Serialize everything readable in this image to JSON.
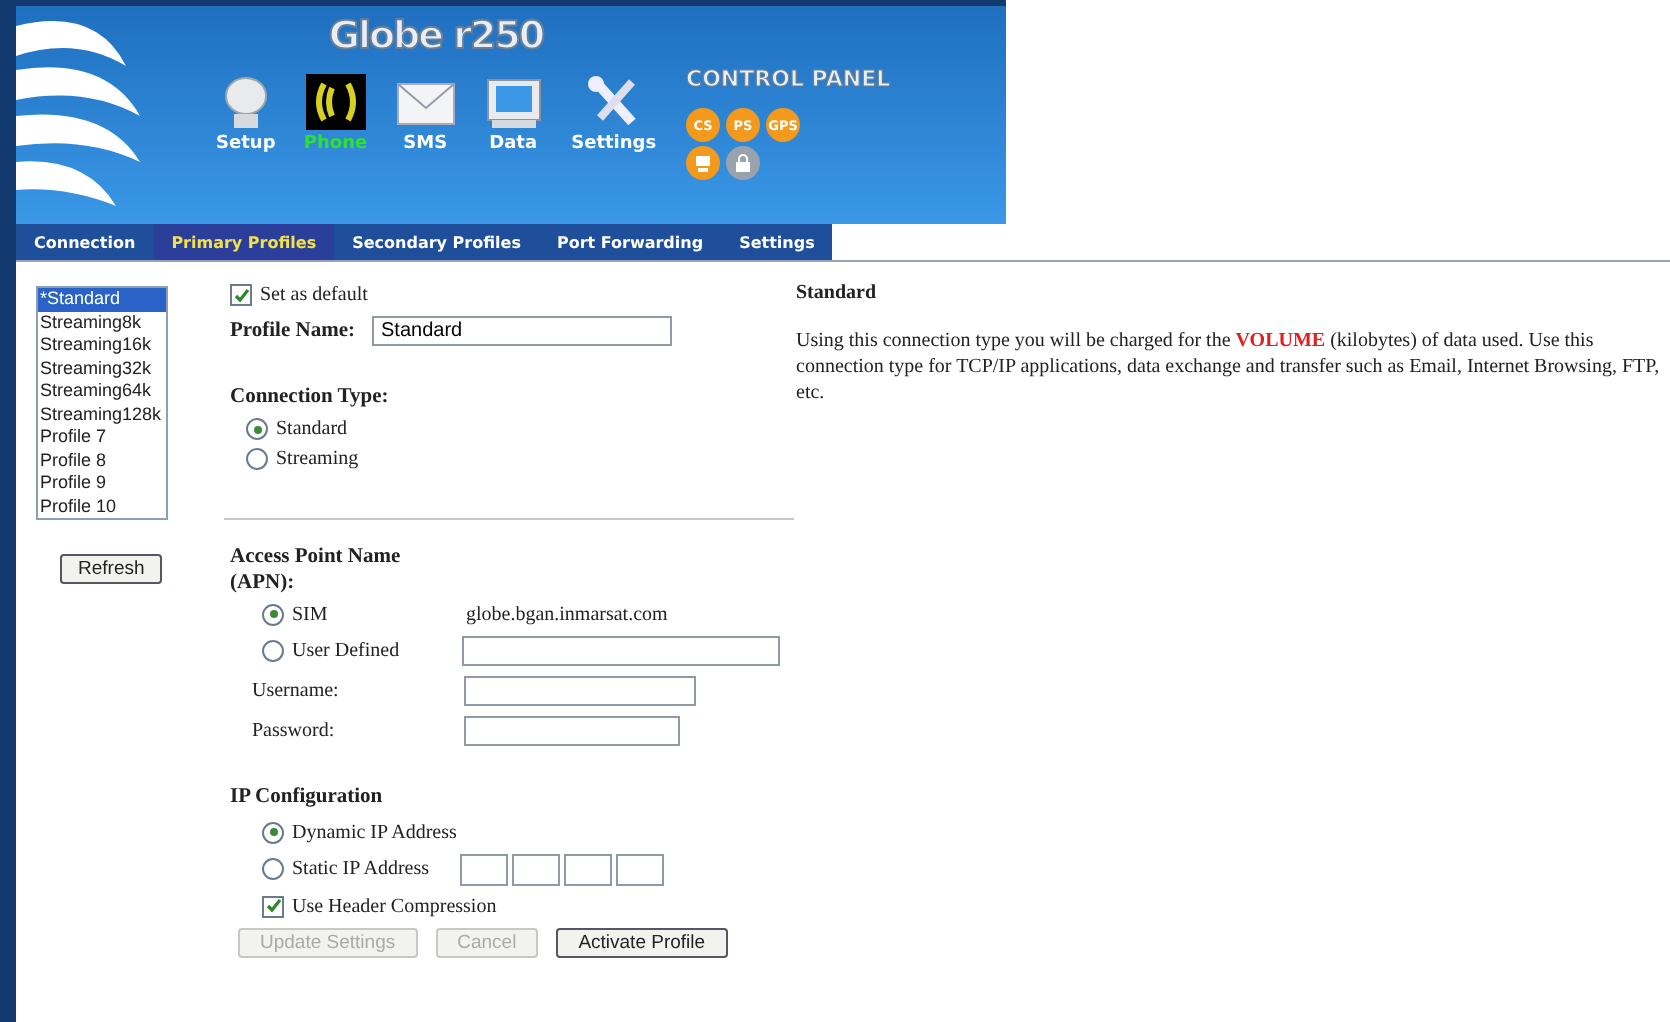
{
  "header": {
    "title": "Globe r250",
    "subtitle": "CONTROL PANEL"
  },
  "nav": [
    {
      "label": "Setup",
      "kind": "setup",
      "selected": false
    },
    {
      "label": "Phone",
      "kind": "phone",
      "selected": true
    },
    {
      "label": "SMS",
      "kind": "sms",
      "selected": false
    },
    {
      "label": "Data",
      "kind": "data",
      "selected": false
    },
    {
      "label": "Settings",
      "kind": "settings",
      "selected": false
    }
  ],
  "status": [
    {
      "label": "CS",
      "kind": "text",
      "on": true
    },
    {
      "label": "PS",
      "kind": "text",
      "on": true
    },
    {
      "label": "GPS",
      "kind": "text",
      "on": true
    },
    {
      "kind": "terminal",
      "on": true
    },
    {
      "kind": "lock",
      "on": false
    }
  ],
  "tabs": [
    {
      "label": "Connection",
      "selected": false
    },
    {
      "label": "Primary Profiles",
      "selected": true
    },
    {
      "label": "Secondary Profiles",
      "selected": false
    },
    {
      "label": "Port Forwarding",
      "selected": false
    },
    {
      "label": "Settings",
      "selected": false
    }
  ],
  "profiles": [
    {
      "label": "*Standard",
      "selected": true
    },
    {
      "label": "Streaming8k",
      "selected": false
    },
    {
      "label": "Streaming16k",
      "selected": false
    },
    {
      "label": "Streaming32k",
      "selected": false
    },
    {
      "label": "Streaming64k",
      "selected": false
    },
    {
      "label": "Streaming128k",
      "selected": false
    },
    {
      "label": "Profile 7",
      "selected": false
    },
    {
      "label": "Profile 8",
      "selected": false
    },
    {
      "label": "Profile 9",
      "selected": false
    },
    {
      "label": "Profile 10",
      "selected": false
    }
  ],
  "refresh_button": "Refresh",
  "form": {
    "set_default": {
      "label": "Set as default",
      "checked": true
    },
    "profile_name": {
      "label": "Profile Name:",
      "value": "Standard"
    },
    "connection_type": {
      "label": "Connection Type:",
      "options": [
        {
          "label": "Standard",
          "selected": true
        },
        {
          "label": "Streaming",
          "selected": false
        }
      ]
    },
    "apn": {
      "label": "Access Point Name (APN):",
      "sim": {
        "label": "SIM",
        "selected": true,
        "value": "globe.bgan.inmarsat.com"
      },
      "user_defined": {
        "label": "User Defined",
        "selected": false
      },
      "username": "Username:",
      "password": "Password:"
    },
    "ip": {
      "label": "IP Configuration",
      "dynamic": {
        "label": "Dynamic IP Address",
        "selected": true
      },
      "static": {
        "label": "Static IP Address",
        "selected": false
      },
      "header_compression": {
        "label": "Use Header Compression",
        "checked": true
      }
    },
    "buttons": [
      {
        "label": "Update Settings",
        "disabled": true
      },
      {
        "label": "Cancel",
        "disabled": true
      },
      {
        "label": "Activate Profile",
        "disabled": false
      }
    ]
  },
  "info": {
    "title": "Standard",
    "before": "Using this connection type you will be charged for the ",
    "highlight": "VOLUME",
    "after": " (kilobytes) of data used. Use this connection type for TCP/IP applications, data exchange and transfer such as Email, Internet Browsing, FTP, etc."
  }
}
